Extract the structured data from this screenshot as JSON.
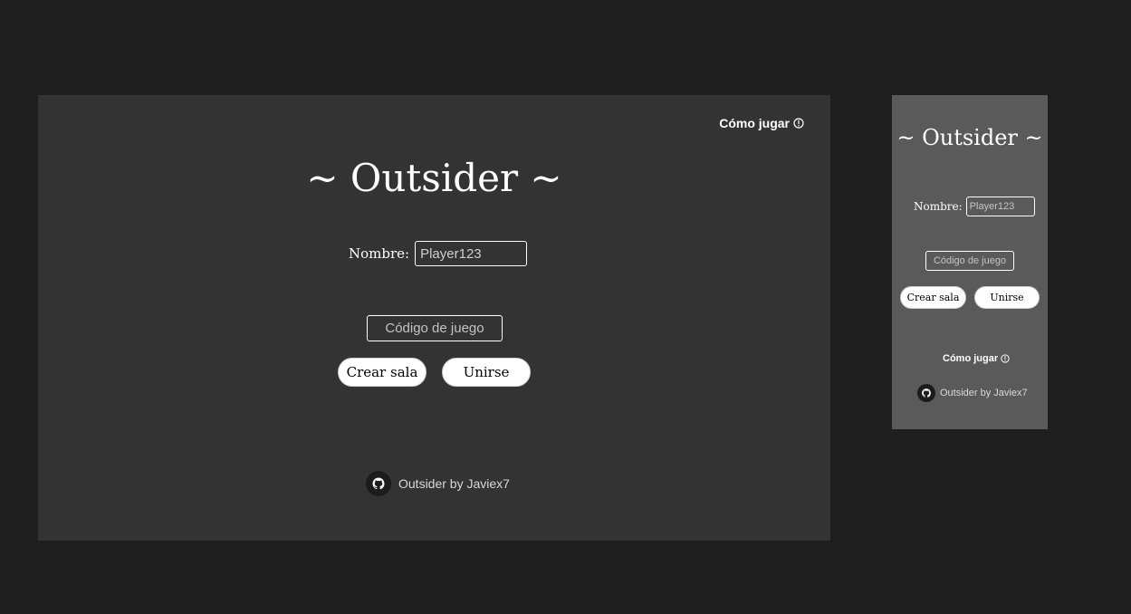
{
  "desktop": {
    "how_to_play": "Cómo jugar",
    "title": "~ Outsider ~",
    "name_label": "Nombre:",
    "name_value": "Player123",
    "code_placeholder": "Código de juego",
    "create_button": "Crear sala",
    "join_button": "Unirse",
    "footer_text": "Outsider by Javiex7"
  },
  "mobile": {
    "title": "~ Outsider ~",
    "name_label": "Nombre:",
    "name_placeholder": "Player123",
    "code_placeholder": "Código de juego",
    "create_button": "Crear sala",
    "join_button": "Unirse",
    "how_to_play": "Cómo jugar",
    "footer_text": "Outsider by Javiex7"
  },
  "icons": {
    "info": "info-icon",
    "github": "github-icon"
  },
  "colors": {
    "canvas": "#1e1e1e",
    "desktop_frame": "#333333",
    "mobile_frame": "#5a5a5a",
    "button_bg": "#ffffff",
    "text": "#ffffff"
  }
}
